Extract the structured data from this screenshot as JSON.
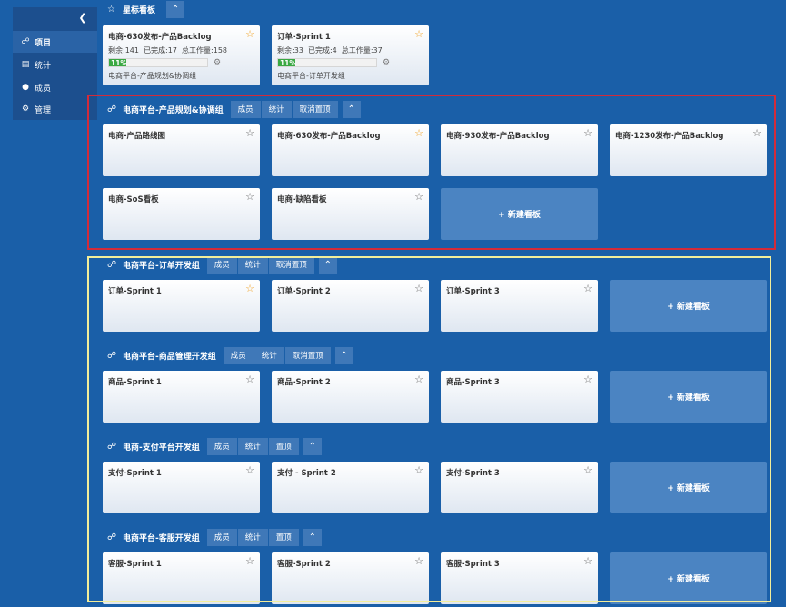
{
  "sidebar": {
    "collapse_icon": "chevron-left-icon",
    "items": [
      {
        "label": "项目",
        "icon": "group-icon"
      },
      {
        "label": "统计",
        "icon": "bar-chart-icon"
      },
      {
        "label": "成员",
        "icon": "users-icon"
      },
      {
        "label": "管理",
        "icon": "gear-icon"
      }
    ]
  },
  "starred": {
    "title": "星标看板",
    "cards": [
      {
        "title": "电商-630发布-产品Backlog",
        "remaining": "剩余:141",
        "done": "已完成:17",
        "total": "总工作量:158",
        "progress": "11%",
        "progress_value": 11,
        "group": "电商平台-产品规划&协调组"
      },
      {
        "title": "订单-Sprint 1",
        "remaining": "剩余:33",
        "done": "已完成:4",
        "total": "总工作量:37",
        "progress": "11%",
        "progress_value": 11,
        "group": "电商平台-订单开发组"
      }
    ]
  },
  "groups": [
    {
      "title": "电商平台-产品规划&协调组",
      "buttons": [
        "成员",
        "统计",
        "取消置顶"
      ],
      "cards": [
        "电商-产品路线图",
        "电商-630发布-产品Backlog",
        "电商-930发布-产品Backlog",
        "电商-1230发布-产品Backlog",
        "电商-SoS看板",
        "电商-缺陷看板"
      ]
    },
    {
      "title": "电商平台-订单开发组",
      "buttons": [
        "成员",
        "统计",
        "取消置顶"
      ],
      "cards": [
        "订单-Sprint 1",
        "订单-Sprint 2",
        "订单-Sprint 3"
      ]
    },
    {
      "title": "电商平台-商品管理开发组",
      "buttons": [
        "成员",
        "统计",
        "取消置顶"
      ],
      "cards": [
        "商品-Sprint 1",
        "商品-Sprint 2",
        "商品-Sprint 3"
      ]
    },
    {
      "title": "电商-支付平台开发组",
      "buttons": [
        "成员",
        "统计",
        "置顶"
      ],
      "cards": [
        "支付-Sprint 1",
        "支付 - Sprint 2",
        "支付-Sprint 3"
      ]
    },
    {
      "title": "电商平台-客服开发组",
      "buttons": [
        "成员",
        "统计",
        "置顶"
      ],
      "cards": [
        "客服-Sprint 1",
        "客服-Sprint 2",
        "客服-Sprint 3"
      ]
    }
  ],
  "new_board_label": "+ 新建看板",
  "colors": {
    "background": "#1a5fa8",
    "star_active": "#f0a020",
    "progress": "#3aa843",
    "highlight_red": "#d32b3a",
    "highlight_yellow": "#f3ee9a"
  }
}
